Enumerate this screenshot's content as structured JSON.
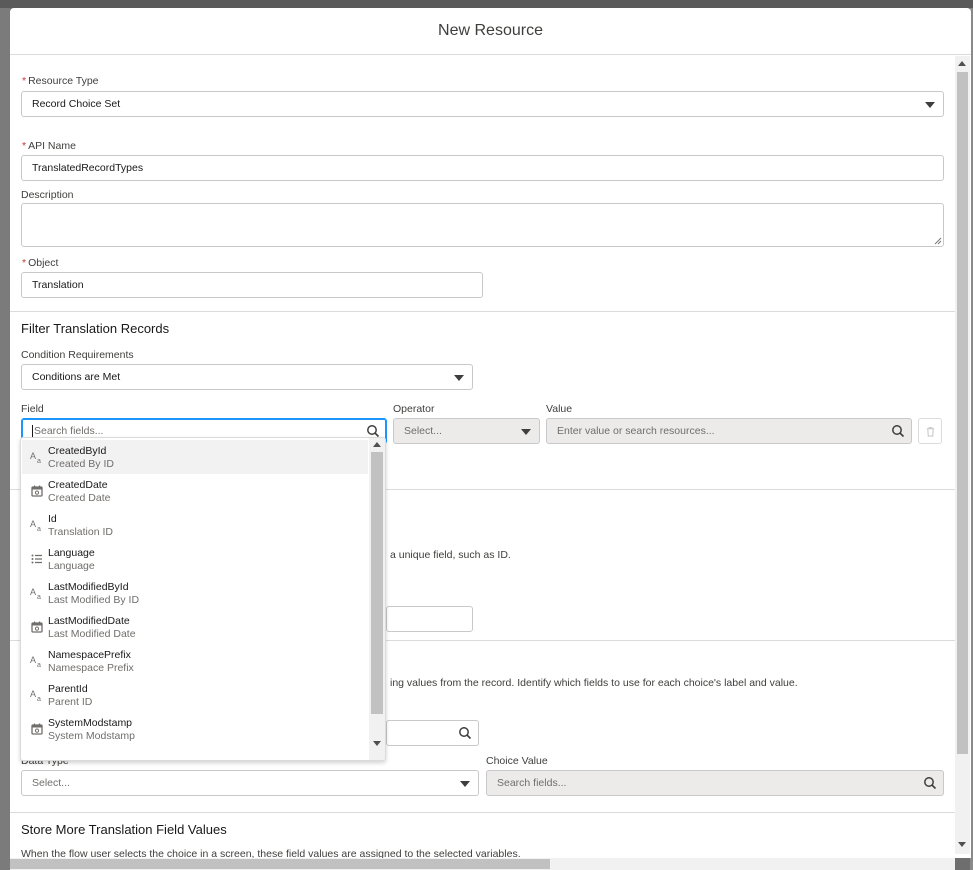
{
  "modal": {
    "title": "New Resource"
  },
  "form": {
    "resource_type": {
      "label": "Resource Type",
      "required": "*",
      "value": "Record Choice Set"
    },
    "api_name": {
      "label": "API Name",
      "required": "*",
      "value": "TranslatedRecordTypes"
    },
    "description": {
      "label": "Description",
      "value": ""
    },
    "object": {
      "label": "Object",
      "required": "*",
      "value": "Translation"
    }
  },
  "filter": {
    "title": "Filter Translation Records",
    "condition_label": "Condition Requirements",
    "condition_value": "Conditions are Met",
    "field_label": "Field",
    "field_placeholder": "Search fields...",
    "operator_label": "Operator",
    "operator_placeholder": "Select...",
    "value_label": "Value",
    "value_placeholder": "Enter value or search resources..."
  },
  "hidden_fragments": {
    "sort_help_tail": "a unique field, such as ID.",
    "choice_help_tail": "ing values from the record. Identify which fields to use for each choice's label and value."
  },
  "choice": {
    "data_type_label": "Data Type",
    "data_type_placeholder": "Select...",
    "choice_value_label": "Choice Value",
    "choice_value_placeholder": "Search fields..."
  },
  "store": {
    "title": "Store More Translation Field Values",
    "help": "When the flow user selects the choice in a screen, these field values are assigned to the selected variables."
  },
  "field_dropdown": {
    "items": [
      {
        "name": "CreatedById",
        "label": "Created By ID",
        "icon": "text-icon"
      },
      {
        "name": "CreatedDate",
        "label": "Created Date",
        "icon": "calendar-icon"
      },
      {
        "name": "Id",
        "label": "Translation ID",
        "icon": "text-icon"
      },
      {
        "name": "Language",
        "label": "Language",
        "icon": "picklist-icon"
      },
      {
        "name": "LastModifiedById",
        "label": "Last Modified By ID",
        "icon": "text-icon"
      },
      {
        "name": "LastModifiedDate",
        "label": "Last Modified Date",
        "icon": "calendar-icon"
      },
      {
        "name": "NamespacePrefix",
        "label": "Namespace Prefix",
        "icon": "text-icon"
      },
      {
        "name": "ParentId",
        "label": "Parent ID",
        "icon": "text-icon"
      },
      {
        "name": "SystemModstamp",
        "label": "System Modstamp",
        "icon": "calendar-icon"
      }
    ]
  },
  "icons": {
    "text": "Aa",
    "search": "search-icon",
    "trash": "trash-icon"
  },
  "colors": {
    "required": "#c23934",
    "focus": "#1b96ff"
  }
}
